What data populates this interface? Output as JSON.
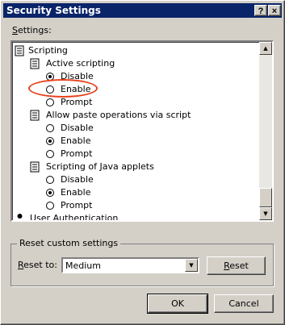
{
  "window": {
    "title": "Security Settings",
    "help_btn": "?",
    "close_btn": "×"
  },
  "settings_label_prefix": "S",
  "settings_label_rest": "ettings:",
  "tree": {
    "root": "Scripting",
    "groups": [
      {
        "label": "Active scripting",
        "options": [
          {
            "label": "Disable",
            "checked": true
          },
          {
            "label": "Enable",
            "checked": false
          },
          {
            "label": "Prompt",
            "checked": false
          }
        ]
      },
      {
        "label": "Allow paste operations via script",
        "options": [
          {
            "label": "Disable",
            "checked": false
          },
          {
            "label": "Enable",
            "checked": true
          },
          {
            "label": "Prompt",
            "checked": false
          }
        ]
      },
      {
        "label": "Scripting of Java applets",
        "options": [
          {
            "label": "Disable",
            "checked": false
          },
          {
            "label": "Enable",
            "checked": true
          },
          {
            "label": "Prompt",
            "checked": false
          }
        ]
      }
    ],
    "last_item": "User Authentication"
  },
  "reset_group": {
    "title": "Reset custom settings",
    "label_prefix": "R",
    "label_rest": "eset to:",
    "value": "Medium",
    "button_prefix": "R",
    "button_rest": "eset"
  },
  "ok_label": "OK",
  "cancel_label": "Cancel",
  "annotation_color": "#e8401c"
}
